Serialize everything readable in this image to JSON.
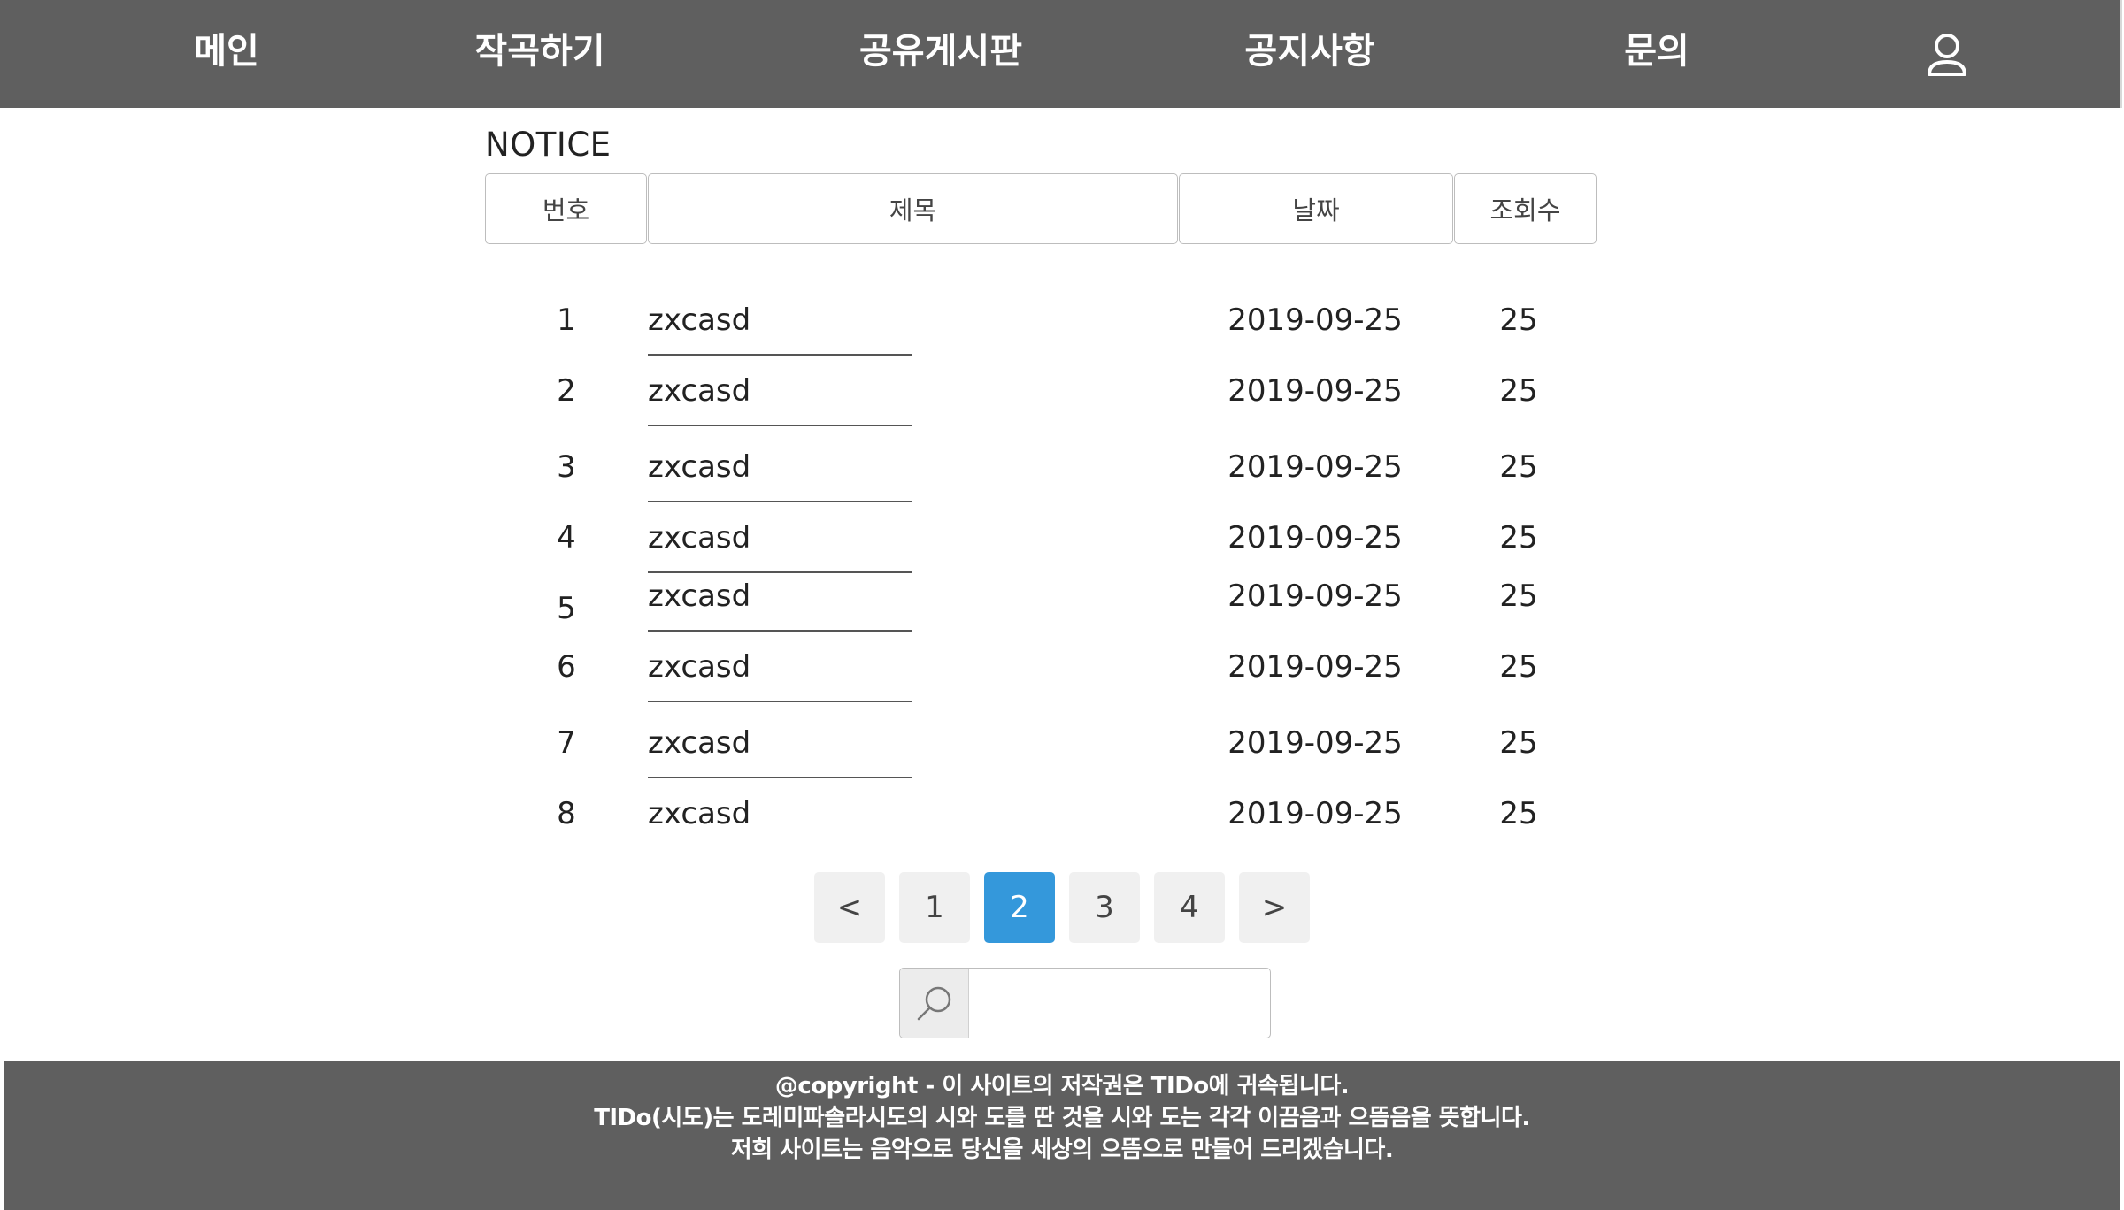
{
  "nav": {
    "items": [
      {
        "label": "메인"
      },
      {
        "label": "작곡하기"
      },
      {
        "label": "공유게시판"
      },
      {
        "label": "공지사항"
      },
      {
        "label": "문의"
      }
    ],
    "user_icon": "user-icon"
  },
  "board": {
    "title": "NOTICE",
    "headers": {
      "num": "번호",
      "title": "제목",
      "date": "날짜",
      "views": "조회수"
    },
    "rows": [
      {
        "num": "1",
        "title": "zxcasd",
        "date": "2019-09-25",
        "views": "25"
      },
      {
        "num": "2",
        "title": "zxcasd",
        "date": "2019-09-25",
        "views": "25"
      },
      {
        "num": "3",
        "title": "zxcasd",
        "date": "2019-09-25",
        "views": "25"
      },
      {
        "num": "4",
        "title": "zxcasd",
        "date": "2019-09-25",
        "views": "25"
      },
      {
        "num": "5",
        "title": "zxcasd",
        "date": "2019-09-25",
        "views": "25"
      },
      {
        "num": "6",
        "title": "zxcasd",
        "date": "2019-09-25",
        "views": "25"
      },
      {
        "num": "7",
        "title": "zxcasd",
        "date": "2019-09-25",
        "views": "25"
      },
      {
        "num": "8",
        "title": "zxcasd",
        "date": "2019-09-25",
        "views": "25"
      }
    ]
  },
  "pagination": {
    "prev": "<",
    "pages": [
      "1",
      "2",
      "3",
      "4"
    ],
    "current": "2",
    "next": ">",
    "active_color": "#3498db"
  },
  "search": {
    "icon": "search-icon",
    "value": "",
    "placeholder": ""
  },
  "footer": {
    "line1": "@copyright - 이 사이트의 저작권은 TIDo에 귀속됩니다.",
    "line2": "TIDo(시도)는 도레미파솔라시도의 시와 도를 딴 것을 시와 도는 각각 이끔음과 으뜸음을 뜻합니다.",
    "line3": "저희 사이트는 음악으로 당신을 세상의 으뜸으로 만들어 드리겠습니다."
  }
}
